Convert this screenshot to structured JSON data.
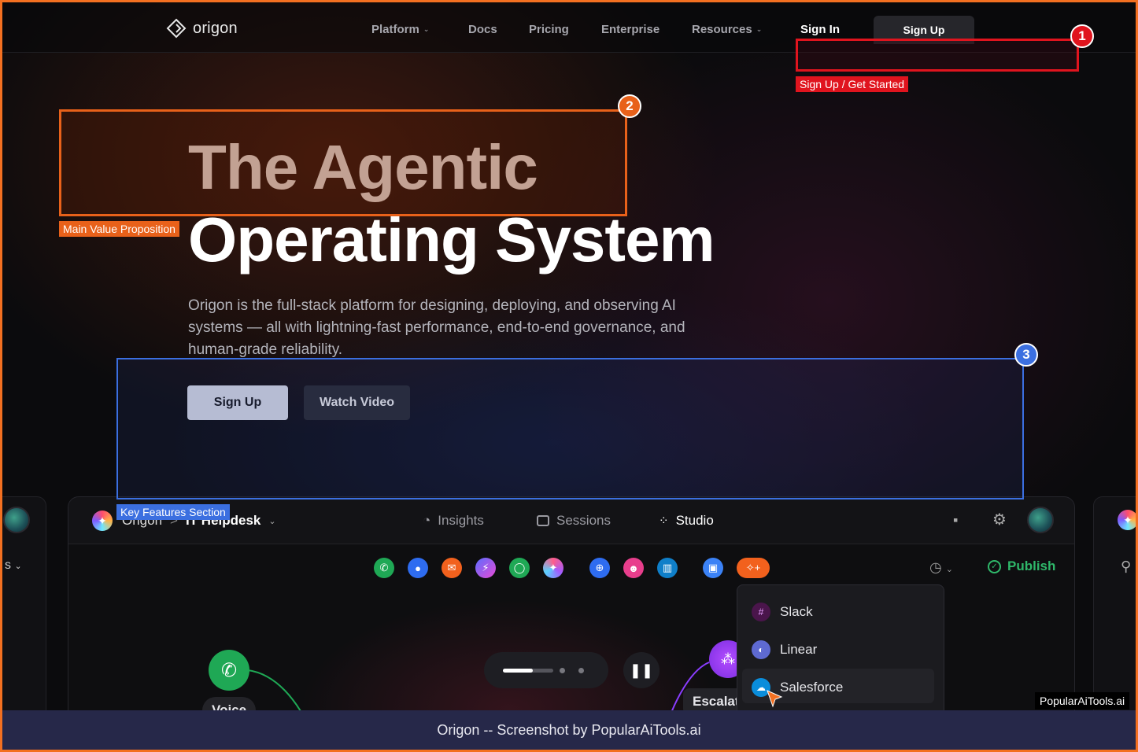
{
  "brand": {
    "name": "origon"
  },
  "nav": {
    "items": [
      {
        "label": "Platform",
        "has_dropdown": true
      },
      {
        "label": "Docs",
        "has_dropdown": false
      },
      {
        "label": "Pricing",
        "has_dropdown": false
      },
      {
        "label": "Enterprise",
        "has_dropdown": false
      },
      {
        "label": "Resources",
        "has_dropdown": true
      }
    ],
    "signin_label": "Sign In",
    "signup_label": "Sign Up"
  },
  "hero": {
    "title_line1": "The Agentic",
    "title_line2": "Operating System",
    "subtitle": "Origon is the full-stack platform for designing, deploying, and observing AI systems — all with lightning-fast performance, end-to-end governance, and human-grade reliability.",
    "primary_button": "Sign Up",
    "secondary_button": "Watch Video"
  },
  "annotations": [
    {
      "number": "1",
      "label": "Sign Up / Get Started",
      "color": "#e0141e"
    },
    {
      "number": "2",
      "label": "Main Value Proposition",
      "color": "#e8611a"
    },
    {
      "number": "3",
      "label": "Key Features Section",
      "color": "#3b6fe0"
    }
  ],
  "app_preview": {
    "breadcrumb_org": "Origon",
    "breadcrumb_sep": ">",
    "workspace": "IT Helpdesk",
    "tabs": [
      {
        "label": "Insights",
        "icon": "pie-chart-icon"
      },
      {
        "label": "Sessions",
        "icon": "sessions-icon"
      },
      {
        "label": "Studio",
        "icon": "studio-icon",
        "active": true
      }
    ],
    "publish_label": "Publish",
    "left_partial_label": "s",
    "channels": [
      "phone",
      "chat",
      "email",
      "messenger",
      "whatsapp",
      "sms",
      "web",
      "team",
      "docs",
      "widget",
      "integrations"
    ],
    "dropdown_items": [
      {
        "label": "Slack",
        "color": "#4a154b"
      },
      {
        "label": "Linear",
        "color": "#5e6ad2"
      },
      {
        "label": "Salesforce",
        "color": "#0a8ddb"
      }
    ],
    "node_voice_label": "Voice",
    "node_escalate_label": "Escalat"
  },
  "footer": {
    "caption": "Origon -- Screenshot by PopularAiTools.ai"
  },
  "watermark": "PopularAiTools.ai",
  "colors": {
    "accent_orange": "#f37021",
    "publish_green": "#2fb86a",
    "footer_bg": "#262849"
  }
}
